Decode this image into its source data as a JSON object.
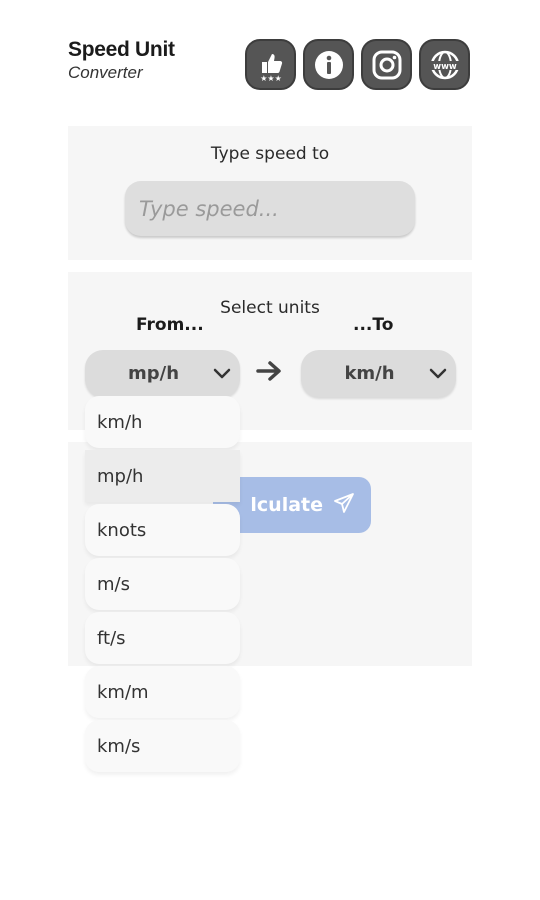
{
  "app": {
    "title": "Speed Unit",
    "subtitle": "Converter"
  },
  "header_icons": [
    {
      "name": "rate-thumbs-up-icon"
    },
    {
      "name": "info-icon"
    },
    {
      "name": "instagram-icon"
    },
    {
      "name": "website-www-icon"
    }
  ],
  "input_section": {
    "label": "Type speed to",
    "placeholder": "Type speed...",
    "value": ""
  },
  "units_section": {
    "label": "Select units",
    "from_label": "From...",
    "to_label": "...To",
    "from_value": "mp/h",
    "to_value": "km/h"
  },
  "calculate_button": {
    "label": "lculate"
  },
  "dropdown": {
    "options": [
      "km/h",
      "mp/h",
      "knots",
      "m/s",
      "ft/s",
      "km/m",
      "km/s"
    ],
    "selected": "mp/h"
  },
  "colors": {
    "button_bg": "#a7bde6",
    "icon_bg": "#555555",
    "panel_bg": "#f6f6f6",
    "select_bg": "#dcdcdc"
  }
}
